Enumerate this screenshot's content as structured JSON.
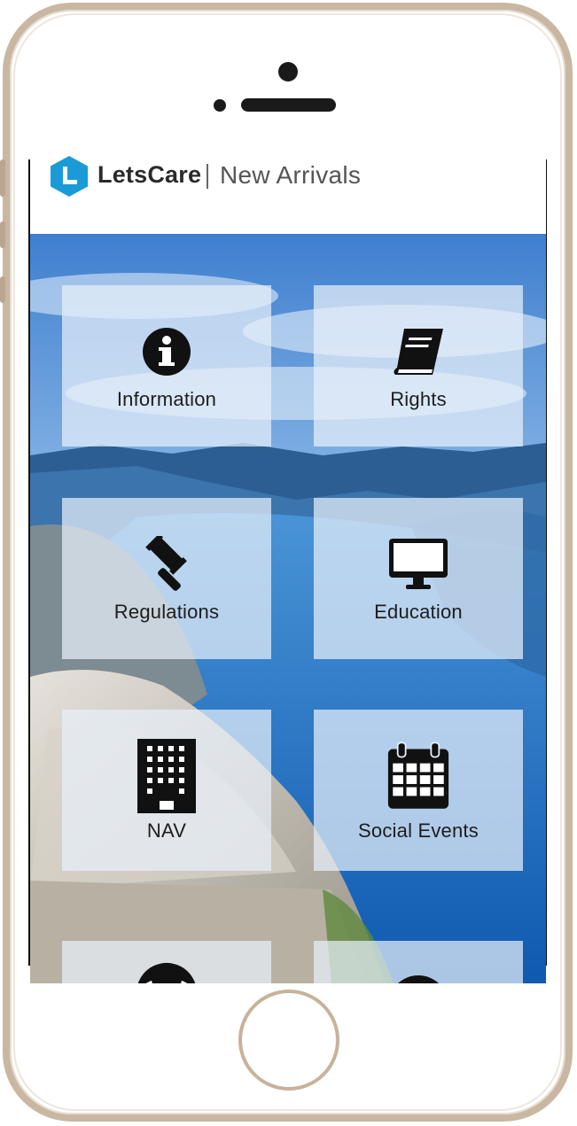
{
  "app": {
    "brand_name": "LetsCare",
    "brand_subtitle": "New Arrivals",
    "brand_color": "#1a9bd7"
  },
  "tiles": [
    {
      "label": "Information",
      "icon": "info-icon"
    },
    {
      "label": "Rights",
      "icon": "book-icon"
    },
    {
      "label": "Regulations",
      "icon": "gavel-icon"
    },
    {
      "label": "Education",
      "icon": "monitor-icon"
    },
    {
      "label": "NAV",
      "icon": "building-icon"
    },
    {
      "label": "Social Events",
      "icon": "calendar-icon"
    },
    {
      "label": "",
      "icon": "soccer-ball-icon"
    },
    {
      "label": "",
      "icon": "dark-circle-icon"
    }
  ]
}
